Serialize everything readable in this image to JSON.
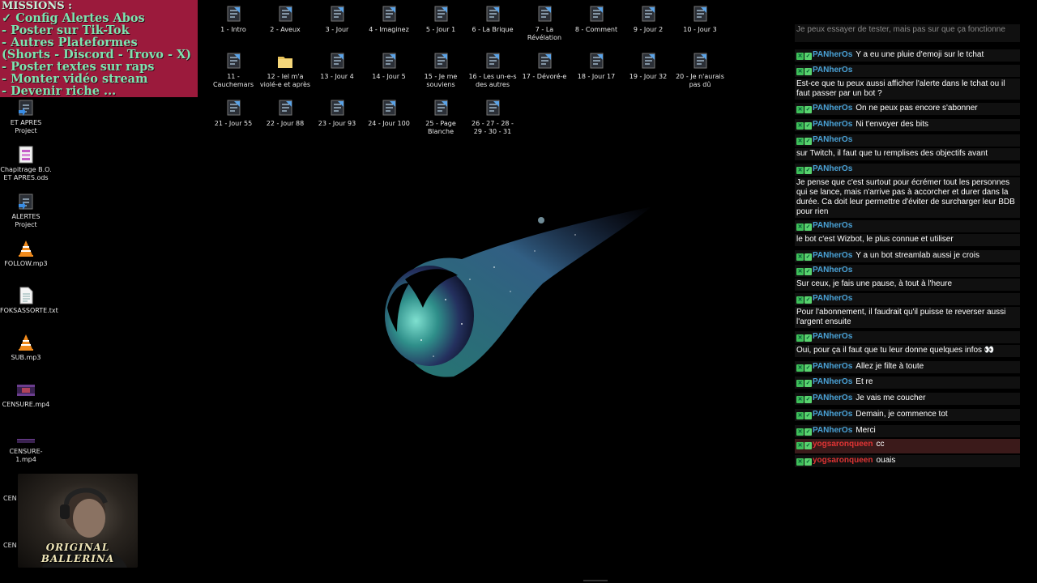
{
  "missions": {
    "title": "MISSIONS :",
    "items": [
      "✓ Config Alertes Abos",
      "- Poster sur Tik-Tok",
      "- Autres Plateformes",
      "(Shorts - Discord - Trovo - X)",
      "- Poster textes sur raps",
      "- Monter vidéo stream",
      "- Devenir riche ..."
    ]
  },
  "desktop": {
    "left_icons": [
      {
        "label": "ET APRES Project",
        "icon": "shortcut-icon"
      },
      {
        "label": "Chapitrage B.O. ET APRES.ods",
        "icon": "spreadsheet-icon"
      },
      {
        "label": "ALERTES Project",
        "icon": "shortcut-icon"
      },
      {
        "label": "FOLLOW.mp3",
        "icon": "vlc-icon"
      },
      {
        "label": "FOKSASSORTE.txt",
        "icon": "text-file-icon"
      },
      {
        "label": "SUB.mp3",
        "icon": "vlc-icon"
      },
      {
        "label": "CENSURE.mp4",
        "icon": "video-icon"
      },
      {
        "label": "CENSURE-1.mp4",
        "icon": "video-icon"
      }
    ],
    "cen_labels": [
      "CEN",
      "CEN"
    ],
    "folders": [
      "1 - Intro",
      "2 - Aveux",
      "3 - Jour",
      "4 - Imaginez",
      "5 - Jour 1",
      "6 - La Brique",
      "7 - La Révélation",
      "8 - Comment",
      "9 - Jour 2",
      "10 - Jour 3",
      "11 - Cauchemars",
      "12 - Iel m'a violé-e et après",
      "13 - Jour 4",
      "14 - Jour 5",
      "15 - Je me souviens",
      "16 - Les un-e-s des autres",
      "17 - Dévoré-e",
      "18 - Jour 17",
      "19 - Jour 32",
      "20 - Je n'aurais pas dû",
      "21 - Jour 55",
      "22 - Jour 88",
      "23 - Jour 93",
      "24 - Jour 100",
      "25 - Page Blanche",
      "26 - 27 - 28 - 29 - 30 - 31"
    ]
  },
  "webcam": {
    "label": "ORIGINAL BALLERINA"
  },
  "chat": {
    "messages": [
      {
        "user": "",
        "text": "Je peux essayer de tester, mais pas sur que ça fonctionne",
        "faded": true
      },
      {
        "user": "PANherOs",
        "text": "Y a eu une pluie d'emoji sur le tchat"
      },
      {
        "user": "PANherOs",
        "text": ""
      },
      {
        "user": "",
        "text": "Est-ce que tu peux aussi afficher l'alerte dans le tchat ou il faut passer par un bot ?"
      },
      {
        "user": "PANherOs",
        "text": "On ne peux pas encore s'abonner"
      },
      {
        "user": "PANherOs",
        "text": "Ni t'envoyer des bits"
      },
      {
        "user": "PANherOs",
        "text": ""
      },
      {
        "user": "",
        "text": "sur Twitch, il faut que tu remplises des objectifs avant"
      },
      {
        "user": "PANherOs",
        "text": ""
      },
      {
        "user": "",
        "text": "Je pense que c'est surtout pour écrémer tout les personnes qui se lance, mais n'arrive pas à accorcher et durer dans la durée. Ca doit leur permettre d'éviter de surcharger leur BDB pour rien"
      },
      {
        "user": "PANherOs",
        "text": ""
      },
      {
        "user": "",
        "text": "le bot c'est Wizbot, le plus connue et utiliser"
      },
      {
        "user": "PANherOs",
        "text": "Y a un bot streamlab aussi je crois"
      },
      {
        "user": "PANherOs",
        "text": ""
      },
      {
        "user": "",
        "text": "Sur ceux, je fais une pause, à tout à l'heure"
      },
      {
        "user": "PANherOs",
        "text": ""
      },
      {
        "user": "",
        "text": "Pour l'abonnement, il faudrait qu'il puisse te reverser aussi l'argent ensuite"
      },
      {
        "user": "PANherOs",
        "text": ""
      },
      {
        "user": "",
        "text": "Oui, pour ça il faut que tu leur donne quelques infos 👀"
      },
      {
        "user": "PANherOs",
        "text": "Allez je filte à toute"
      },
      {
        "user": "PANherOs",
        "text": "Et re"
      },
      {
        "user": "PANherOs",
        "text": "Je vais me coucher"
      },
      {
        "user": "PANherOs",
        "text": "Demain, je commence tot"
      },
      {
        "user": "PANherOs",
        "text": "Merci"
      },
      {
        "user": "yogsaronqueen",
        "text": "cc",
        "highlight": true
      },
      {
        "user": "yogsaronqueen",
        "text": "ouais"
      }
    ]
  },
  "colors": {
    "missions_bg": "#9b1a3c",
    "missions_text": "#7de3b0",
    "panheros": "#4aa3d8",
    "yogsaronqueen": "#e03434",
    "badge": "#3fbf5a"
  }
}
